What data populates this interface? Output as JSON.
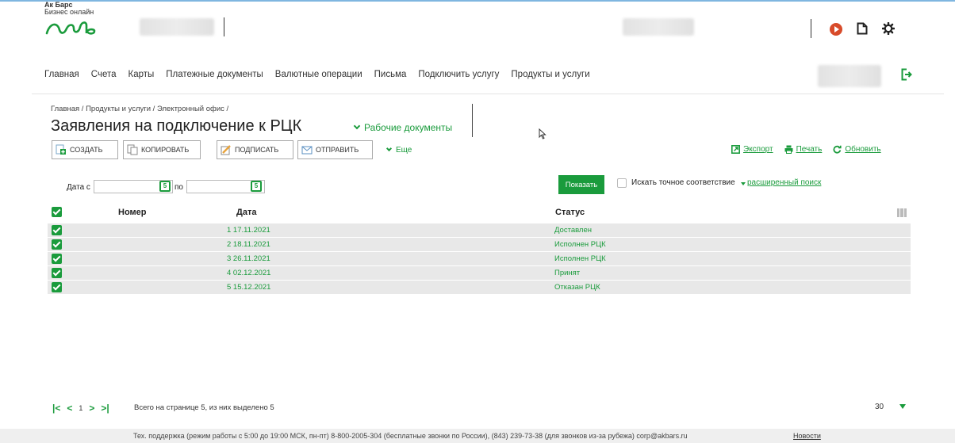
{
  "header": {
    "logo_line1": "Ак Барс",
    "logo_line2": "Бизнес онлайн"
  },
  "nav": {
    "items": [
      "Главная",
      "Счета",
      "Карты",
      "Платежные документы",
      "Валютные операции",
      "Письма",
      "Подключить услугу",
      "Продукты и услуги"
    ]
  },
  "breadcrumb": "Главная / Продукты и услуги / Электронный офис /",
  "page_title": "Заявления на подключение к РЦК",
  "work_docs_label": "Рабочие документы",
  "toolbar": {
    "create": "СОЗДАТЬ",
    "copy": "КОПИРОВАТЬ",
    "sign": "ПОДПИСАТЬ",
    "send": "ОТПРАВИТЬ",
    "more": "Еще",
    "export": "Экспорт",
    "print": "Печать",
    "refresh": "Обновить"
  },
  "filter": {
    "date_from_label": "Дата с",
    "date_to_label": "по",
    "date_from_value": "",
    "date_to_value": "",
    "show_button": "Показать",
    "exact_match_label": "Искать точное соответствие",
    "advanced_search": "расширенный поиск"
  },
  "table": {
    "headers": {
      "number": "Номер",
      "date": "Дата",
      "status": "Статус"
    },
    "rows": [
      {
        "date": "1 17.11.2021",
        "status": "Доставлен"
      },
      {
        "date": "2 18.11.2021",
        "status": "Исполнен РЦК"
      },
      {
        "date": "3 26.11.2021",
        "status": "Исполнен РЦК"
      },
      {
        "date": "4 02.12.2021",
        "status": "Принят"
      },
      {
        "date": "5 15.12.2021",
        "status": "Отказан РЦК"
      }
    ]
  },
  "pager": {
    "current_page": "1",
    "info": "Всего на странице 5, из них выделено 5",
    "per_page": "30"
  },
  "footer": {
    "support": "Тех. поддержка (режим работы с 5:00 до 19:00 МСК, пн-пт) 8-800-2005-304 (бесплатные звонки по России), (843) 239-73-38 (для звонков из-за рубежа) corp@akbars.ru",
    "news": "Новости"
  },
  "colors": {
    "accent": "#1a9b3c",
    "record": "#d84b2a"
  },
  "icons": [
    "record-icon",
    "document-icon",
    "gear-icon",
    "logout-icon",
    "calendar-icon",
    "export-icon",
    "print-icon",
    "refresh-icon",
    "column-settings-icon"
  ]
}
